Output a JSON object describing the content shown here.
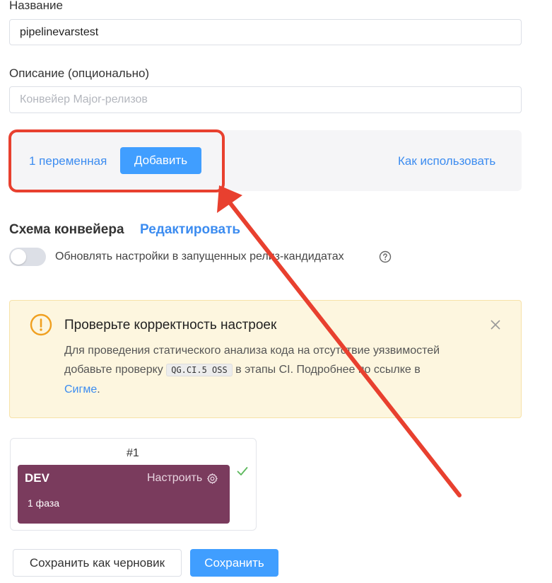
{
  "form": {
    "name_label": "Название",
    "name_value": "pipelinevarstest",
    "description_label": "Описание (опционально)",
    "description_placeholder": "Конвейер Major-релизов"
  },
  "variables": {
    "count_link": "1 переменная",
    "add_button": "Добавить",
    "how_to_link": "Как использовать"
  },
  "schema": {
    "title": "Схема конвейера",
    "edit_link": "Редактировать",
    "toggle_label": "Обновлять настройки в запущенных релиз-кандидатах",
    "toggle_on": false,
    "help_icon": "question-circle-icon"
  },
  "alert": {
    "icon": "warning-circle-icon",
    "title": "Проверьте корректность настроек",
    "text_1": "Для проведения статического анализа кода на отсутствие уязвимостей",
    "text_2": "добавьте проверку",
    "code": "QG.CI.5 OSS",
    "text_3": "в этапы CI. Подробнее по ссылке в",
    "link": "Сигме",
    "text_end": ".",
    "close_icon": "close-icon"
  },
  "stage": {
    "number": "#1",
    "name": "DEV",
    "configure": "Настроить",
    "phases": "1 фаза",
    "status_icon": "check-icon"
  },
  "footer": {
    "draft_button": "Сохранить как черновик",
    "save_button": "Сохранить"
  },
  "annotation": {
    "color": "#e8402f"
  }
}
